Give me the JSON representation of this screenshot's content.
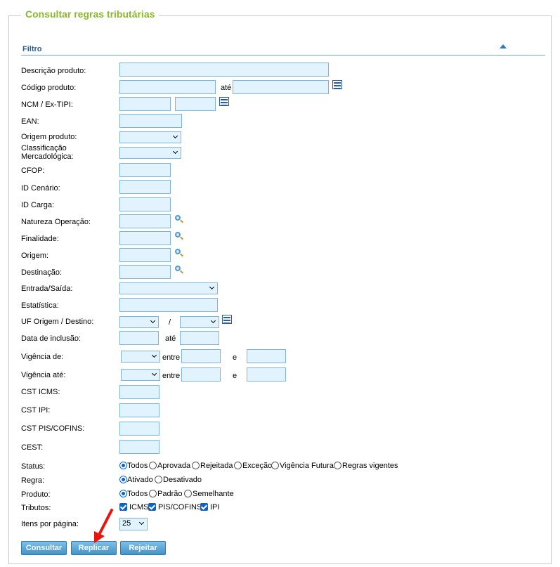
{
  "page": {
    "title": "Consultar regras tributárias",
    "filter_title": "Filtro"
  },
  "fields": {
    "descricao_produto": "Descrição produto:",
    "codigo_produto": "Código produto:",
    "ate": "até",
    "ncm": "NCM / Ex-TIPI:",
    "ean": "EAN:",
    "origem_produto": "Origem produto:",
    "classificacao": "Classificação Mercadológica:",
    "cfop": "CFOP:",
    "id_cenario": "ID Cenário:",
    "id_carga": "ID Carga:",
    "natureza_operacao": "Natureza Operação:",
    "finalidade": "Finalidade:",
    "origem": "Origem:",
    "destinacao": "Destinação:",
    "entrada_saida": "Entrada/Saída:",
    "estatistica": "Estatística:",
    "uf": "UF Origem / Destino:",
    "slash": "/",
    "data_inclusao": "Data de inclusão:",
    "vigencia_de": "Vigência de:",
    "vigencia_ate": "Vigência até:",
    "entre": "entre",
    "e": "e",
    "cst_icms": "CST ICMS:",
    "cst_ipi": "CST IPI:",
    "cst_pis": "CST PIS/COFINS:",
    "cest": "CEST:",
    "status": "Status:",
    "regra": "Regra:",
    "produto": "Produto:",
    "tributos": "Tributos:",
    "itens_por_pagina": "Itens por página:"
  },
  "status_options": [
    "Todos",
    "Aprovada",
    "Rejeitada",
    "Exceção",
    "Vigência Futura",
    "Regras vigentes"
  ],
  "status_selected": "Todos",
  "regra_options": [
    "Ativado",
    "Desativado"
  ],
  "regra_selected": "Ativado",
  "produto_options": [
    "Todos",
    "Padrão",
    "Semelhante"
  ],
  "produto_selected": "Todos",
  "tributos_options": [
    "ICMS",
    "PIS/COFINS",
    "IPI"
  ],
  "tributos_checked": [
    "ICMS",
    "PIS/COFINS",
    "IPI"
  ],
  "itens_por_pagina_value": "25",
  "buttons": {
    "consultar": "Consultar",
    "replicar": "Replicar",
    "rejeitar": "Rejeitar"
  },
  "colors": {
    "title_green": "#8db72a",
    "input_bg": "#e1f3ff",
    "button_blue": "#4493c7",
    "annotation_red": "#e8140e"
  },
  "icons": [
    "collapse-up-icon",
    "list-icon",
    "magnifier-icon",
    "chevron-down-icon",
    "red-arrow-annotation"
  ]
}
